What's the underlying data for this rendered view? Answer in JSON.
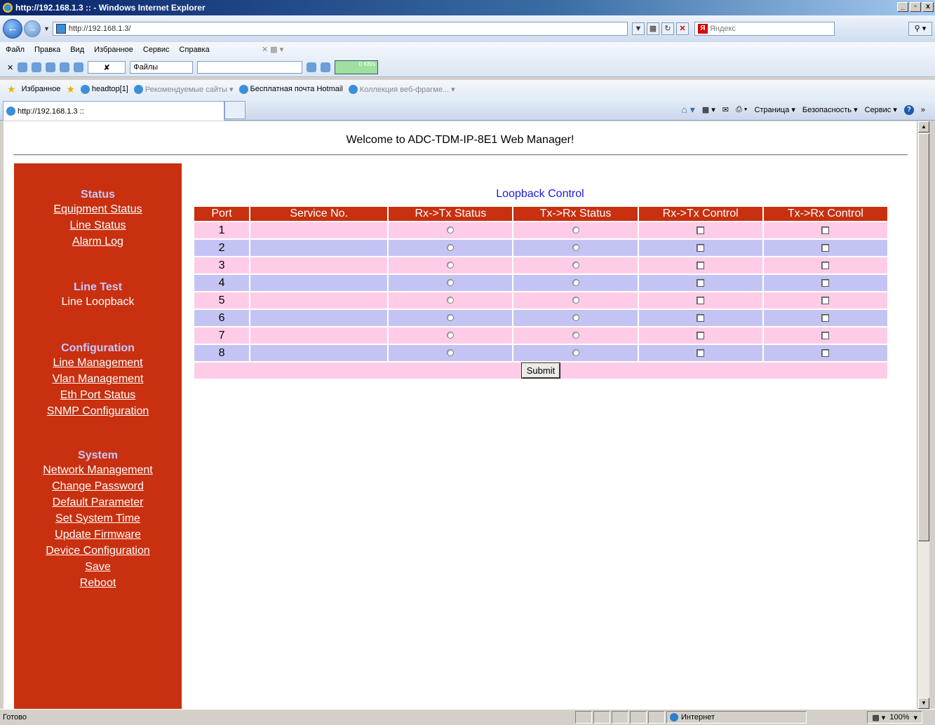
{
  "window": {
    "title": "http://192.168.1.3 :: - Windows Internet Explorer",
    "buttons": [
      "_",
      "▫",
      "x"
    ]
  },
  "addressbar": {
    "url": "http://192.168.1.3/",
    "search_placeholder": "Яндекс"
  },
  "menu": [
    "Файл",
    "Правка",
    "Вид",
    "Избранное",
    "Сервис",
    "Справка"
  ],
  "toolbar": {
    "files_label": "Файлы",
    "speed": "0 KB/s"
  },
  "favorites": {
    "label": "Избранное",
    "items": [
      {
        "label": "headtop[1]",
        "grey": false
      },
      {
        "label": "Рекомендуемые сайты ▾",
        "grey": true
      },
      {
        "label": "Бесплатная почта Hotmail",
        "grey": false
      },
      {
        "label": "Коллекция веб-фрагме... ▾",
        "grey": true
      }
    ]
  },
  "tab": {
    "title": "http://192.168.1.3 ::"
  },
  "commandbar": [
    "Страница ▾",
    "Безопасность ▾",
    "Сервис ▾"
  ],
  "page": {
    "welcome": "Welcome to ADC-TDM-IP-8E1 Web Manager!"
  },
  "sidebar": {
    "status_title": "Status",
    "status_links": [
      "Equipment Status",
      "Line Status",
      "Alarm Log"
    ],
    "linetest_title": "Line Test",
    "linetest_items": [
      "Line Loopback"
    ],
    "config_title": "Configuration",
    "config_links": [
      "Line Management",
      "Vlan Management",
      "Eth Port Status",
      "SNMP Configuration"
    ],
    "system_title": "System",
    "system_links": [
      "Network Management",
      "Change Password",
      "Default Parameter",
      "Set System Time",
      "Update Firmware",
      "Device Configuration",
      "Save",
      "Reboot"
    ]
  },
  "loopback": {
    "title": "Loopback Control",
    "headers": [
      "Port",
      "Service No.",
      "Rx->Tx Status",
      "Tx->Rx Status",
      "Rx->Tx Control",
      "Tx->Rx Control"
    ],
    "ports": [
      "1",
      "2",
      "3",
      "4",
      "5",
      "6",
      "7",
      "8"
    ],
    "submit": "Submit"
  },
  "statusbar": {
    "text": "Готово",
    "zone": "Интернет",
    "zoom": "100%"
  }
}
